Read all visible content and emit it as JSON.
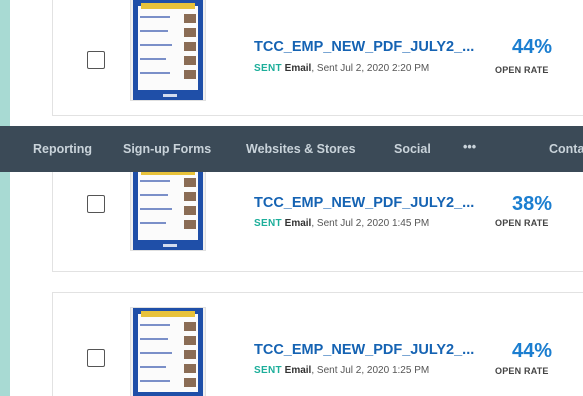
{
  "nav": {
    "items": [
      "Reporting",
      "Sign-up Forms",
      "Websites & Stores",
      "Social",
      "•••",
      "Conta"
    ]
  },
  "campaigns": [
    {
      "title": "TCC_EMP_NEW_PDF_JULY2_...",
      "status": "SENT",
      "type": "Email",
      "sent": ", Sent Jul 2, 2020 2:20 PM",
      "open_rate": "44%",
      "open_rate_label": "OPEN RATE"
    },
    {
      "title": "TCC_EMP_NEW_PDF_JULY2_...",
      "status": "SENT",
      "type": "Email",
      "sent": ", Sent Jul 2, 2020 1:45 PM",
      "open_rate": "38%",
      "open_rate_label": "OPEN RATE"
    },
    {
      "title": "TCC_EMP_NEW_PDF_JULY2_...",
      "status": "SENT",
      "type": "Email",
      "sent": ", Sent Jul 2, 2020 1:25 PM",
      "open_rate": "44%",
      "open_rate_label": "OPEN RATE"
    }
  ]
}
